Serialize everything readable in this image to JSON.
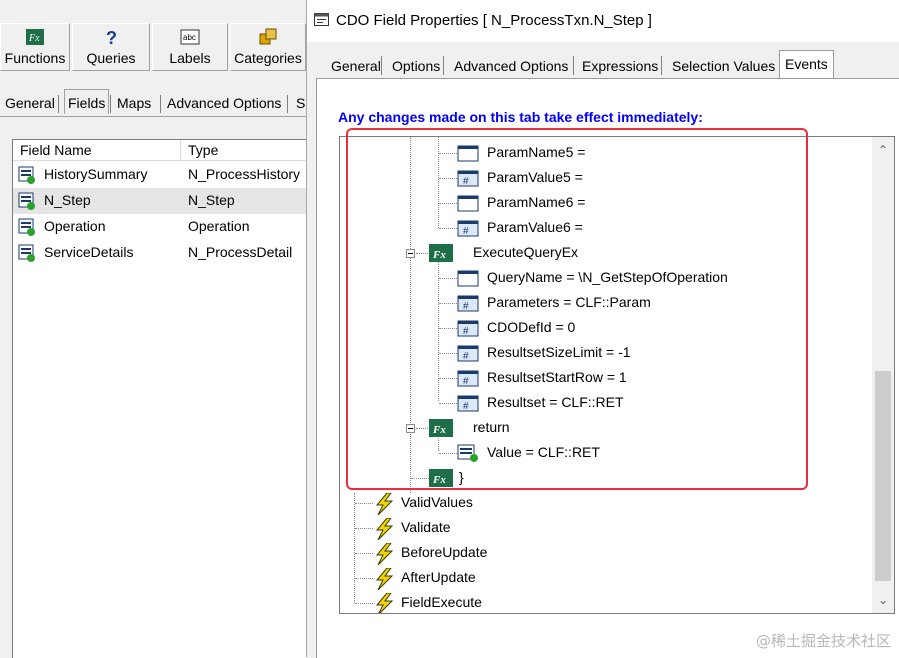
{
  "left_window": {
    "toolbar": [
      {
        "label": "Functions",
        "icon": "function-icon"
      },
      {
        "label": "Queries",
        "icon": "question-icon"
      },
      {
        "label": "Labels",
        "icon": "label-icon"
      },
      {
        "label": "Categories",
        "icon": "categories-icon"
      }
    ],
    "tabs": [
      "General",
      "Fields",
      "Maps",
      "Advanced Options",
      "S"
    ],
    "active_tab": "Fields",
    "columns": [
      "Field Name",
      "Type"
    ],
    "rows": [
      {
        "name": "HistorySummary",
        "type": "N_ProcessHistory"
      },
      {
        "name": "N_Step",
        "type": "N_Step",
        "selected": true
      },
      {
        "name": "Operation",
        "type": "Operation"
      },
      {
        "name": "ServiceDetails",
        "type": "N_ProcessDetail"
      }
    ]
  },
  "dialog": {
    "title": "CDO Field Properties [ N_ProcessTxn.N_Step ]",
    "tabs": [
      "General",
      "Options",
      "Advanced Options",
      "Expressions",
      "Selection Values",
      "Events"
    ],
    "active_tab": "Events",
    "notice": "Any changes made on this tab take effect immediately:",
    "notice_color": "#0000ff",
    "highlight_color": "#e8303a",
    "tree": [
      {
        "text": "ParamName5 =",
        "icon": "param-name-icon"
      },
      {
        "text": "ParamValue5 =",
        "icon": "param-value-icon"
      },
      {
        "text": "ParamName6 =",
        "icon": "param-name-icon"
      },
      {
        "text": "ParamValue6 =",
        "icon": "param-value-icon"
      },
      {
        "text": "ExecuteQueryEx",
        "icon": "function-node-icon"
      },
      {
        "text": "QueryName = \\N_GetStepOfOperation",
        "icon": "param-name-icon"
      },
      {
        "text": "Parameters = CLF::Param",
        "icon": "param-value-icon"
      },
      {
        "text": "CDODefId = 0",
        "icon": "param-value-icon"
      },
      {
        "text": "ResultsetSizeLimit = -1",
        "icon": "param-value-icon"
      },
      {
        "text": "ResultsetStartRow = 1",
        "icon": "param-value-icon"
      },
      {
        "text": "Resultset = CLF::RET",
        "icon": "param-value-icon"
      },
      {
        "text": "return",
        "icon": "function-node-icon"
      },
      {
        "text": "Value = CLF::RET",
        "icon": "value-icon"
      },
      {
        "text": "}",
        "icon": "function-node-icon"
      },
      {
        "text": "ValidValues",
        "icon": "lightning-icon"
      },
      {
        "text": "Validate",
        "icon": "lightning-icon"
      },
      {
        "text": "BeforeUpdate",
        "icon": "lightning-icon"
      },
      {
        "text": "AfterUpdate",
        "icon": "lightning-icon"
      },
      {
        "text": "FieldExecute",
        "icon": "lightning-icon"
      }
    ]
  },
  "watermark": "@稀土掘金技术社区"
}
